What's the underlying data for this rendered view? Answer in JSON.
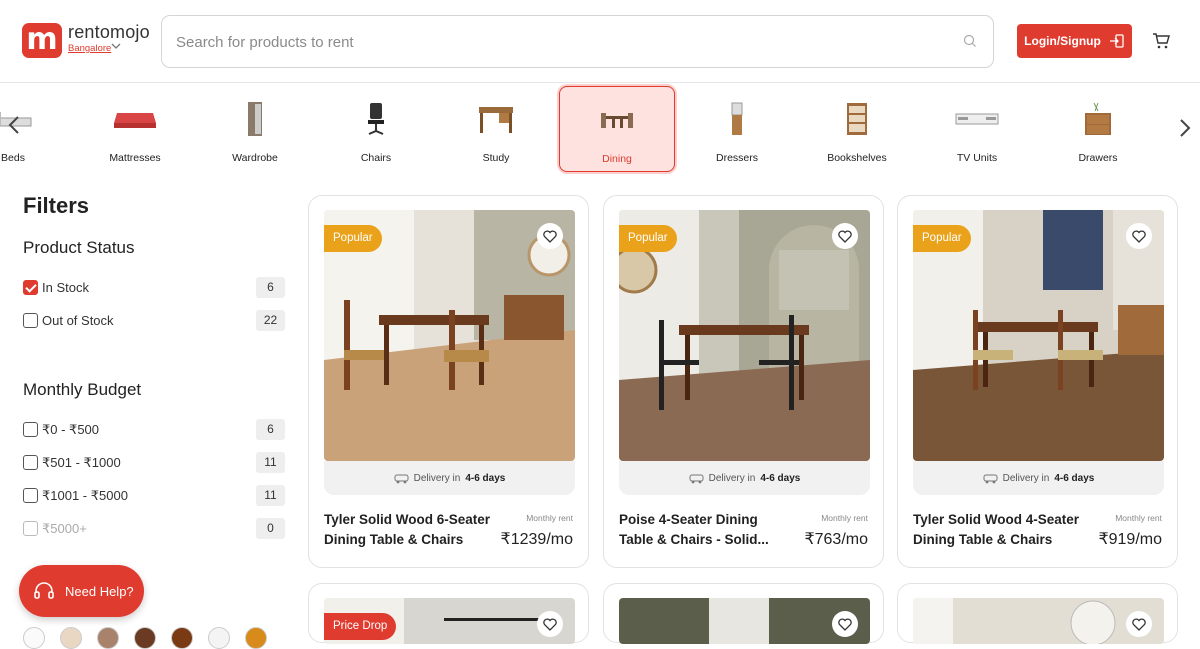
{
  "header": {
    "brand": "rentomojo",
    "city": "Bangalore",
    "search_placeholder": "Search for products to rent",
    "login_label": "Login/Signup"
  },
  "categories": [
    {
      "label": "Beds"
    },
    {
      "label": "Mattresses"
    },
    {
      "label": "Wardrobe"
    },
    {
      "label": "Chairs"
    },
    {
      "label": "Study"
    },
    {
      "label": "Dining",
      "active": true
    },
    {
      "label": "Dressers"
    },
    {
      "label": "Bookshelves"
    },
    {
      "label": "TV Units"
    },
    {
      "label": "Drawers"
    }
  ],
  "filters": {
    "title": "Filters",
    "status_title": "Product Status",
    "status": [
      {
        "label": "In Stock",
        "count": "6",
        "checked": true
      },
      {
        "label": "Out of Stock",
        "count": "22",
        "checked": false
      }
    ],
    "budget_title": "Monthly Budget",
    "budget": [
      {
        "label": "₹0 - ₹500",
        "count": "6"
      },
      {
        "label": "₹501 - ₹1000",
        "count": "11"
      },
      {
        "label": "₹1001 - ₹5000",
        "count": "11"
      },
      {
        "label": "₹5000+",
        "count": "0",
        "disabled": true
      }
    ]
  },
  "help": {
    "label": "Need Help?"
  },
  "delivery": {
    "prefix": "Delivery in",
    "days": "4-6 days"
  },
  "monthly_label": "Monthly rent",
  "products": [
    {
      "badge": "Popular",
      "name_line1": "Tyler Solid Wood 6-Seater",
      "name_line2": "Dining Table & Chairs",
      "price": "₹1239/mo"
    },
    {
      "badge": "Popular",
      "name_line1": "Poise 4-Seater Dining",
      "name_line2": "Table & Chairs - Solid...",
      "price": "₹763/mo"
    },
    {
      "badge": "Popular",
      "name_line1": "Tyler Solid Wood 4-Seater",
      "name_line2": "Dining Table & Chairs",
      "price": "₹919/mo"
    },
    {
      "badge": "Price Drop"
    }
  ],
  "colors": {
    "accent": "#df3b2f",
    "badge_popular": "#eaa21a"
  }
}
